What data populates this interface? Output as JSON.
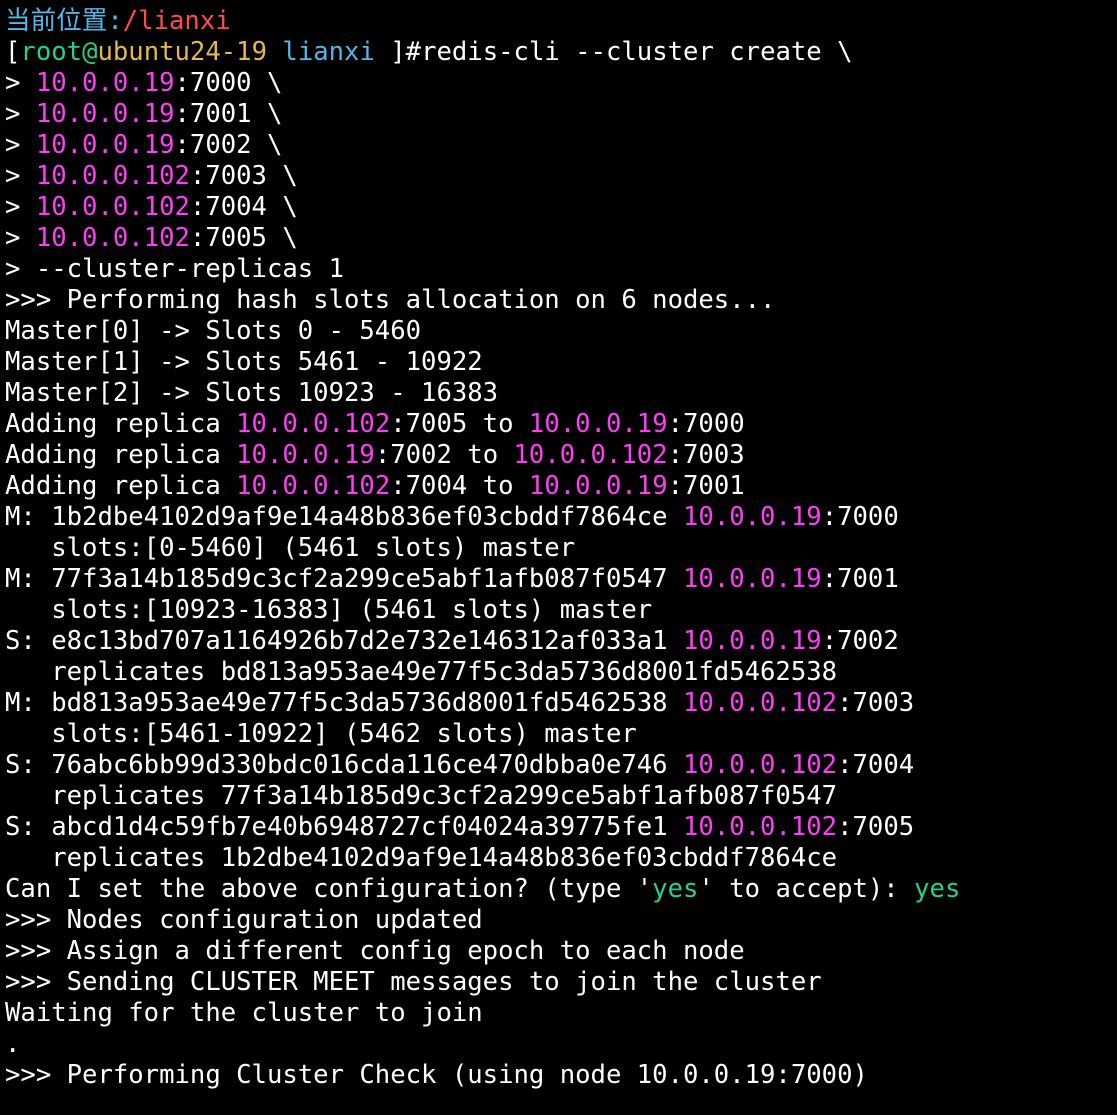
{
  "terminal": {
    "colors": {
      "background": "#000000",
      "default": "#ffffff",
      "ip": "#ff3df5",
      "path_label": "#4fb8e8",
      "path": "#ff4c4c",
      "user": "#23d18b",
      "host": "#e5b84c",
      "dir": "#4fb8e8",
      "yes": "#23d18b"
    },
    "lines": [
      [
        {
          "t": "当前位置:",
          "c": "path_label"
        },
        {
          "t": "/lianxi",
          "c": "path"
        }
      ],
      [
        {
          "t": "["
        },
        {
          "t": "root",
          "c": "user"
        },
        {
          "t": "@",
          "c": "user"
        },
        {
          "t": "ubuntu24-19",
          "c": "host"
        },
        {
          "t": " "
        },
        {
          "t": "lianxi",
          "c": "dir"
        },
        {
          "t": " ]#redis-cli --cluster create \\"
        }
      ],
      [
        {
          "t": "> "
        },
        {
          "t": "10.0.0.19",
          "c": "ip"
        },
        {
          "t": ":7000 \\"
        }
      ],
      [
        {
          "t": "> "
        },
        {
          "t": "10.0.0.19",
          "c": "ip"
        },
        {
          "t": ":7001 \\"
        }
      ],
      [
        {
          "t": "> "
        },
        {
          "t": "10.0.0.19",
          "c": "ip"
        },
        {
          "t": ":7002 \\"
        }
      ],
      [
        {
          "t": "> "
        },
        {
          "t": "10.0.0.102",
          "c": "ip"
        },
        {
          "t": ":7003 \\"
        }
      ],
      [
        {
          "t": "> "
        },
        {
          "t": "10.0.0.102",
          "c": "ip"
        },
        {
          "t": ":7004 \\"
        }
      ],
      [
        {
          "t": "> "
        },
        {
          "t": "10.0.0.102",
          "c": "ip"
        },
        {
          "t": ":7005 \\"
        }
      ],
      [
        {
          "t": "> --cluster-replicas 1"
        }
      ],
      [
        {
          "t": ">>> Performing hash slots allocation on 6 nodes..."
        }
      ],
      [
        {
          "t": "Master[0] -> Slots 0 - 5460"
        }
      ],
      [
        {
          "t": "Master[1] -> Slots 5461 - 10922"
        }
      ],
      [
        {
          "t": "Master[2] -> Slots 10923 - 16383"
        }
      ],
      [
        {
          "t": "Adding replica "
        },
        {
          "t": "10.0.0.102",
          "c": "ip"
        },
        {
          "t": ":7005 to "
        },
        {
          "t": "10.0.0.19",
          "c": "ip"
        },
        {
          "t": ":7000"
        }
      ],
      [
        {
          "t": "Adding replica "
        },
        {
          "t": "10.0.0.19",
          "c": "ip"
        },
        {
          "t": ":7002 to "
        },
        {
          "t": "10.0.0.102",
          "c": "ip"
        },
        {
          "t": ":7003"
        }
      ],
      [
        {
          "t": "Adding replica "
        },
        {
          "t": "10.0.0.102",
          "c": "ip"
        },
        {
          "t": ":7004 to "
        },
        {
          "t": "10.0.0.19",
          "c": "ip"
        },
        {
          "t": ":7001"
        }
      ],
      [
        {
          "t": "M: 1b2dbe4102d9af9e14a48b836ef03cbddf7864ce "
        },
        {
          "t": "10.0.0.19",
          "c": "ip"
        },
        {
          "t": ":7000"
        }
      ],
      [
        {
          "t": "   slots:[0-5460] (5461 slots) master"
        }
      ],
      [
        {
          "t": "M: 77f3a14b185d9c3cf2a299ce5abf1afb087f0547 "
        },
        {
          "t": "10.0.0.19",
          "c": "ip"
        },
        {
          "t": ":7001"
        }
      ],
      [
        {
          "t": "   slots:[10923-16383] (5461 slots) master"
        }
      ],
      [
        {
          "t": "S: e8c13bd707a1164926b7d2e732e146312af033a1 "
        },
        {
          "t": "10.0.0.19",
          "c": "ip"
        },
        {
          "t": ":7002"
        }
      ],
      [
        {
          "t": "   replicates bd813a953ae49e77f5c3da5736d8001fd5462538"
        }
      ],
      [
        {
          "t": "M: bd813a953ae49e77f5c3da5736d8001fd5462538 "
        },
        {
          "t": "10.0.0.102",
          "c": "ip"
        },
        {
          "t": ":7003"
        }
      ],
      [
        {
          "t": "   slots:[5461-10922] (5462 slots) master"
        }
      ],
      [
        {
          "t": "S: 76abc6bb99d330bdc016cda116ce470dbba0e746 "
        },
        {
          "t": "10.0.0.102",
          "c": "ip"
        },
        {
          "t": ":7004"
        }
      ],
      [
        {
          "t": "   replicates 77f3a14b185d9c3cf2a299ce5abf1afb087f0547"
        }
      ],
      [
        {
          "t": "S: abcd1d4c59fb7e40b6948727cf04024a39775fe1 "
        },
        {
          "t": "10.0.0.102",
          "c": "ip"
        },
        {
          "t": ":7005"
        }
      ],
      [
        {
          "t": "   replicates 1b2dbe4102d9af9e14a48b836ef03cbddf7864ce"
        }
      ],
      [
        {
          "t": "Can I set the above configuration? (type '"
        },
        {
          "t": "yes",
          "c": "yes"
        },
        {
          "t": "' to accept): "
        },
        {
          "t": "yes",
          "c": "yes"
        }
      ],
      [
        {
          "t": ">>> Nodes configuration updated"
        }
      ],
      [
        {
          "t": ">>> Assign a different config epoch to each node"
        }
      ],
      [
        {
          "t": ">>> Sending CLUSTER MEET messages to join the cluster"
        }
      ],
      [
        {
          "t": "Waiting for the cluster to join"
        }
      ],
      [
        {
          "t": "."
        }
      ],
      [
        {
          "t": ">>> Performing Cluster Check (using node 10.0.0.19:7000)"
        }
      ]
    ]
  }
}
